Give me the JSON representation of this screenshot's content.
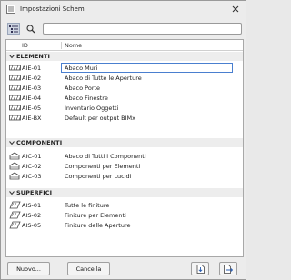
{
  "window": {
    "title": "Impostazioni Schemi"
  },
  "list": {
    "columns": {
      "id": "ID",
      "name": "Nome"
    },
    "groups": [
      {
        "label": "ELEMENTI",
        "items": [
          {
            "id": "AIE-01",
            "name": "Abaco Muri",
            "selected": true
          },
          {
            "id": "AIE-02",
            "name": "Abaco di Tutte le Aperture"
          },
          {
            "id": "AIE-03",
            "name": "Abaco Porte"
          },
          {
            "id": "AIE-04",
            "name": "Abaco Finestre"
          },
          {
            "id": "AIE-05",
            "name": "Inventario Oggetti"
          },
          {
            "id": "AIE-BX",
            "name": "Default per output BIMx"
          }
        ]
      },
      {
        "label": "COMPONENTI",
        "items": [
          {
            "id": "AIC-01",
            "name": "Abaco di Tutti i Componenti"
          },
          {
            "id": "AIC-02",
            "name": "Componenti per Elementi"
          },
          {
            "id": "AIC-03",
            "name": "Componenti per Lucidi"
          }
        ]
      },
      {
        "label": "SUPERFICI",
        "items": [
          {
            "id": "AIS-01",
            "name": "Tutte le finiture"
          },
          {
            "id": "AIS-02",
            "name": "Finiture per Elementi"
          },
          {
            "id": "AIS-05",
            "name": "Finiture delle Aperture"
          }
        ]
      }
    ]
  },
  "buttons": {
    "new": "Nuovo...",
    "cancel": "Cancella"
  },
  "icons": {
    "app": "schedule-settings-icon",
    "close": "close-icon",
    "list_view": "list-view-icon",
    "search": "search-icon",
    "elements": "wall-element-icon",
    "components": "component-icon",
    "surfaces": "surface-icon",
    "import": "import-icon",
    "export": "export-icon"
  },
  "colors": {
    "selection": "#4a7fcf",
    "group_bg": "#ededed"
  }
}
